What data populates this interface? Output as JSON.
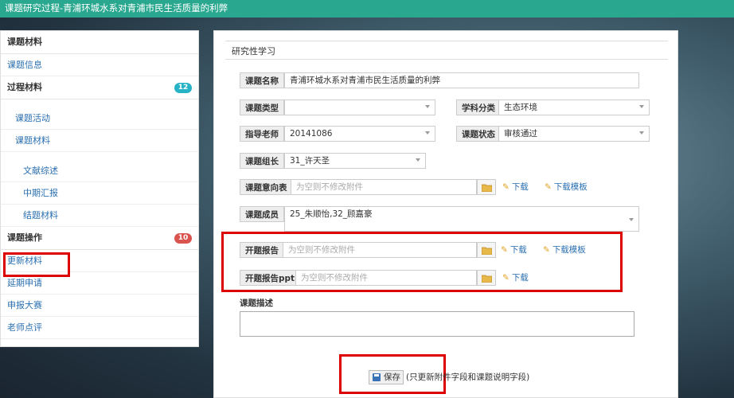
{
  "window": {
    "title": "课题研究过程-青浦环城水系对青浦市民生活质量的利弊"
  },
  "sidebar": {
    "section1_title": "课题材料",
    "topic_info": "课题信息",
    "section2_title": "过程材料",
    "section2_badge": "12",
    "activity": "课题活动",
    "materials": "课题材料",
    "lit_review": "文献综述",
    "midterm": "中期汇报",
    "final": "结题材料",
    "section3_title": "课题操作",
    "section3_badge": "10",
    "update": "更新材料",
    "extend": "延期申请",
    "apply_contest": "申报大赛",
    "teacher_review": "老师点评"
  },
  "form": {
    "section_title": "研究性学习",
    "name_label": "课题名称",
    "name_value": "青浦环城水系对青浦市民生活质量的利弊",
    "type_label": "课题类型",
    "type_value": "",
    "subject_label": "学科分类",
    "subject_value": "生态环境",
    "teacher_label": "指导老师",
    "teacher_value": "20141086",
    "status_label": "课题状态",
    "status_value": "审核通过",
    "leader_label": "课题组长",
    "leader_value": "31_许天圣",
    "intent_label": "课题意向表",
    "attach_placeholder": "为空则不修改附件",
    "download": "下载",
    "download_template": "下载模板",
    "members_label": "课题成员",
    "members_value": "25_朱顺怡,32_顾嘉豪",
    "opening_label": "开题报告",
    "opening_ppt_label": "开题报告ppt",
    "desc_label": "课题描述",
    "save_button": "保存",
    "save_note": "(只更新附件字段和课题说明字段)"
  },
  "colors": {
    "topbar": "#2aa88f",
    "link": "#2a6fb0",
    "highlight": "#dd0000"
  }
}
